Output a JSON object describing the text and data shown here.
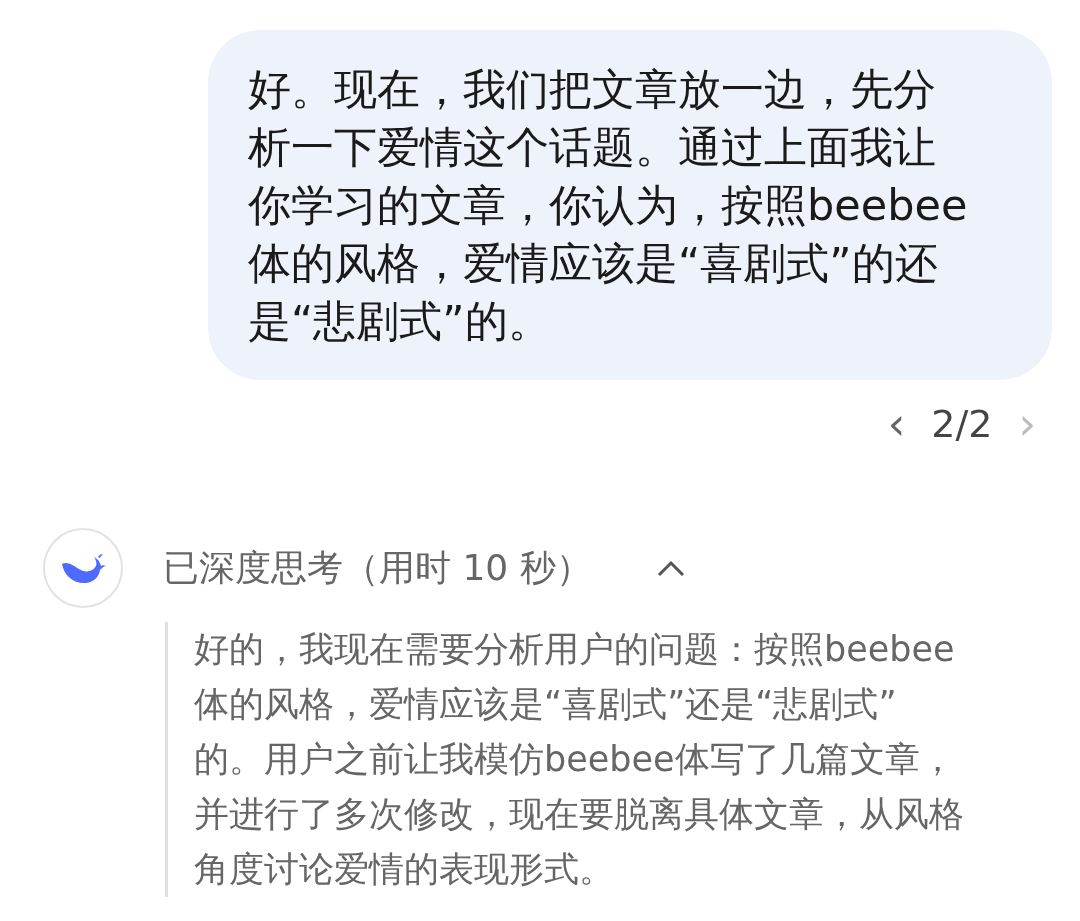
{
  "user_message": {
    "lines": [
      "好。现在，我们把文章放一边，先分",
      "析一下爱情这个话题。通过上面我让",
      "你学习的文章，你认为，按照beebee",
      "体的风格，爱情应该是“喜剧式”的还",
      "是“悲剧式”的。"
    ]
  },
  "pager": {
    "prev": "‹",
    "position": "2/2",
    "next": "›"
  },
  "thinking": {
    "title": "已深度思考（用时 10 秒）",
    "expanded": true,
    "lines": [
      "好的，我现在需要分析用户的问题：按照beebee",
      "体的风格，爱情应该是“喜剧式”还是“悲剧式”",
      "的。用户之前让我模仿beebee体写了几篇文章，",
      "并进行了多次修改，现在要脱离具体文章，从风格",
      "角度讨论爱情的表现形式。"
    ]
  }
}
